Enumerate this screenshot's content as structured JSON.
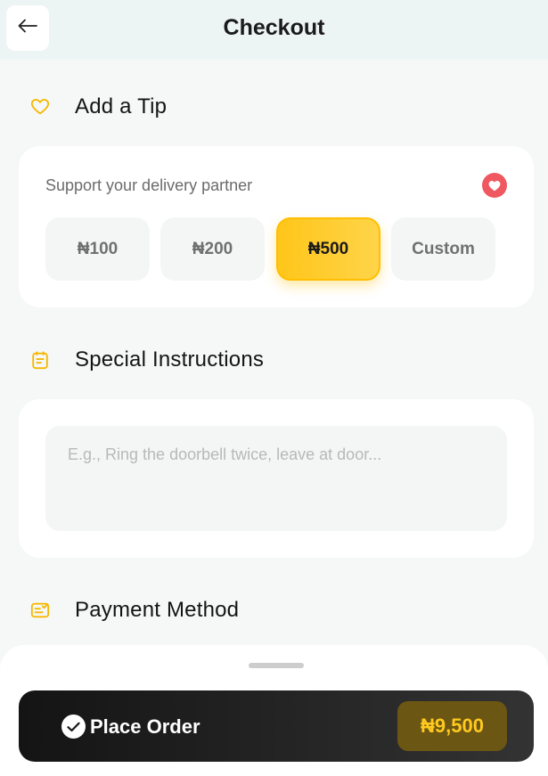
{
  "header": {
    "title": "Checkout",
    "back_icon": "arrow-left-icon"
  },
  "tip_section": {
    "title": "Add a Tip",
    "icon": "heart-outline-icon",
    "prompt": "Support your delivery partner",
    "badge_icon": "heart-filled-icon",
    "options": [
      {
        "label": "₦100",
        "selected": false
      },
      {
        "label": "₦200",
        "selected": false
      },
      {
        "label": "₦500",
        "selected": true
      },
      {
        "label": "Custom",
        "selected": false
      }
    ]
  },
  "instructions_section": {
    "title": "Special Instructions",
    "icon": "clipboard-icon",
    "placeholder": "E.g., Ring the doorbell twice, leave at door...",
    "value": ""
  },
  "payment_section": {
    "title": "Payment Method",
    "icon": "payment-card-icon"
  },
  "footer": {
    "button_label": "Place Order",
    "button_icon": "check-circle-icon",
    "total": "₦9,500"
  },
  "colors": {
    "accent": "#ffc61a",
    "accent_border": "#ffbf00",
    "heart": "#ef5861",
    "dark_button": "#1c1c1c",
    "total_text": "#ffc91f",
    "background": "#f6f8f8"
  }
}
